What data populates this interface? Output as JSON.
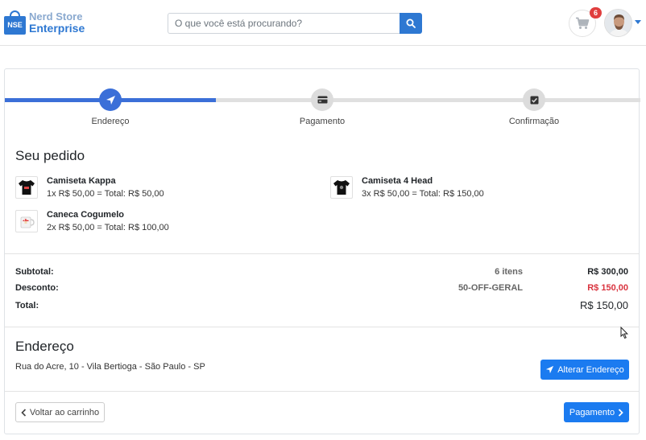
{
  "header": {
    "logo_badge": "NSE",
    "logo_line1": "Nerd Store",
    "logo_line2": "Enterprise",
    "search_placeholder": "O que você está procurando?",
    "search_icon": "search-icon",
    "cart_icon": "shopping-cart-icon",
    "cart_count": "6",
    "avatar": "user-avatar"
  },
  "stepper": {
    "steps": [
      {
        "label": "Endereço",
        "icon": "paper-plane-icon",
        "state": "active"
      },
      {
        "label": "Pagamento",
        "icon": "credit-card-icon",
        "state": "inactive"
      },
      {
        "label": "Confirmação",
        "icon": "check-square-icon",
        "state": "inactive"
      }
    ]
  },
  "order": {
    "title": "Seu pedido",
    "items": [
      {
        "name": "Camiseta Kappa",
        "detail": "1x R$ 50,00 = Total: R$ 50,00"
      },
      {
        "name": "Camiseta 4 Head",
        "detail": "3x R$ 50,00 = Total: R$ 150,00"
      },
      {
        "name": "Caneca Cogumelo",
        "detail": "2x R$ 50,00 = Total: R$ 100,00"
      }
    ]
  },
  "summary": {
    "subtotal_label": "Subtotal:",
    "subtotal_items": "6 itens",
    "subtotal_value": "R$ 300,00",
    "discount_label": "Desconto:",
    "discount_code": "50-OFF-GERAL",
    "discount_value": "R$ 150,00",
    "total_label": "Total:",
    "total_value": "R$ 150,00",
    "discount_color": "#d9343f"
  },
  "address": {
    "title": "Endereço",
    "text": "Rua do Acre, 10 - Vila Bertioga - São Paulo - SP",
    "change_button": "Alterar Endereço"
  },
  "footer": {
    "back_button": "Voltar ao carrinho",
    "next_button": "Pagamento"
  },
  "colors": {
    "primary": "#1b7bf0",
    "brand": "#2e78d2",
    "stepper_active": "#3b6fd8"
  }
}
